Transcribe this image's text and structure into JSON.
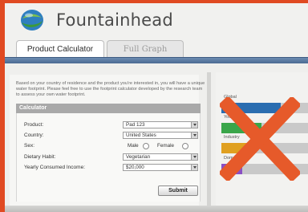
{
  "app": {
    "title": "Fountainhead",
    "logo_icon": "globe-icon",
    "brand_frame_color": "#e04a22"
  },
  "tabs": [
    {
      "label": "Product Calculator",
      "active": true
    },
    {
      "label": "Full Graph",
      "active": false
    }
  ],
  "intro_text": "Based on your country of residence and the product you're interested in, you will have a unique water footprint. Please feel free to use the footprint calculator developed by the research team to assess your own water footprint.",
  "calculator": {
    "header": "Calculator",
    "fields": {
      "product": {
        "label": "Product:",
        "value": "Pad 123"
      },
      "country": {
        "label": "Country:",
        "value": "United States"
      },
      "sex": {
        "label": "Sex:",
        "options": [
          "Male",
          "Female"
        ]
      },
      "diet": {
        "label": "Dietary Habit:",
        "value": "Vegetarian"
      },
      "income": {
        "label": "Yearly Consumed Income:",
        "value": "$20,000"
      }
    },
    "submit_label": "Submit"
  },
  "graph": {
    "rows": [
      {
        "label": "Global",
        "color": "#2a6db0"
      },
      {
        "label": "Yours",
        "color": "#3aa64a"
      },
      {
        "label": "Industry",
        "color": "#e0a020"
      },
      {
        "label": "Domestic",
        "color": "#8a4fc4"
      }
    ],
    "overlay_icon": "cross-out-icon",
    "overlay_color": "#e65a2a"
  }
}
